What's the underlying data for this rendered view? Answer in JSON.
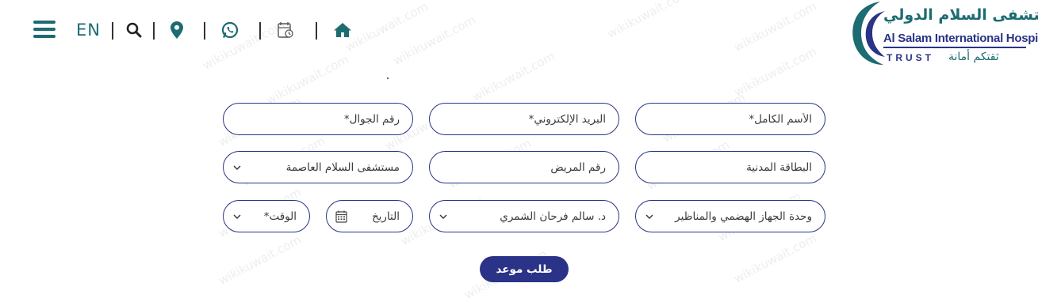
{
  "header": {
    "language_label": "EN",
    "icons": [
      "menu-icon",
      "search-icon",
      "location-icon",
      "whatsapp-icon",
      "appointment-icon",
      "home-icon"
    ]
  },
  "logo": {
    "arabic_name": "مستشفى السلام الدولي",
    "english_name": "Al Salam International Hospital",
    "trust": "TRUST",
    "slogan": "ثقتكم أمانة"
  },
  "watermark": "wikikuwait.com",
  "form": {
    "full_name_placeholder": "الأسم الكامل*",
    "email_placeholder": "البريد الإلكتروني*",
    "mobile_placeholder": "رقم الجوال*",
    "civil_id_placeholder": "البطاقة المدنية",
    "patient_number_placeholder": "رقم المريض",
    "hospital_selected": "مستشفى السلام العاصمة",
    "department_selected": "وحدة الجهاز الهضمي والمناظير",
    "doctor_selected": "د. سالم فرحان الشمري",
    "date_placeholder": "التاريخ",
    "time_placeholder": "الوقت*",
    "submit_label": "طلب موعد"
  },
  "colors": {
    "brand_teal": "#1c6c72",
    "brand_navy": "#2a3387"
  }
}
